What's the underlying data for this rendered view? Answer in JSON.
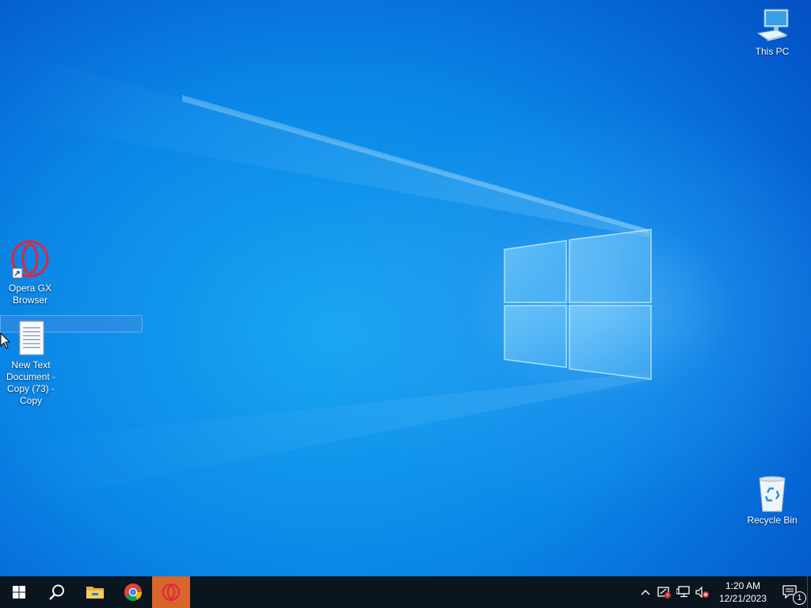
{
  "desktop": {
    "icons": [
      {
        "id": "this-pc",
        "label": "This PC"
      },
      {
        "id": "opera-gx",
        "label": "Opera GX Browser"
      },
      {
        "id": "text-doc",
        "label": "New Text Document - Copy (73) - Copy"
      },
      {
        "id": "recycle-bin",
        "label": "Recycle Bin"
      }
    ]
  },
  "taskbar": {
    "buttons": [
      {
        "name": "start",
        "icon": "windows-logo-icon"
      },
      {
        "name": "search",
        "icon": "search-icon"
      },
      {
        "name": "file-explorer",
        "icon": "folder-icon"
      },
      {
        "name": "chrome",
        "icon": "chrome-icon"
      },
      {
        "name": "opera-gx",
        "icon": "opera-gx-icon",
        "state": "active"
      }
    ],
    "tray": {
      "time": "1:20 AM",
      "date": "12/21/2023",
      "notification_count": "1"
    }
  },
  "colors": {
    "taskbar_bg": "#0b1520",
    "active_app": "#d8652a",
    "opera_red": "#e0263f"
  }
}
